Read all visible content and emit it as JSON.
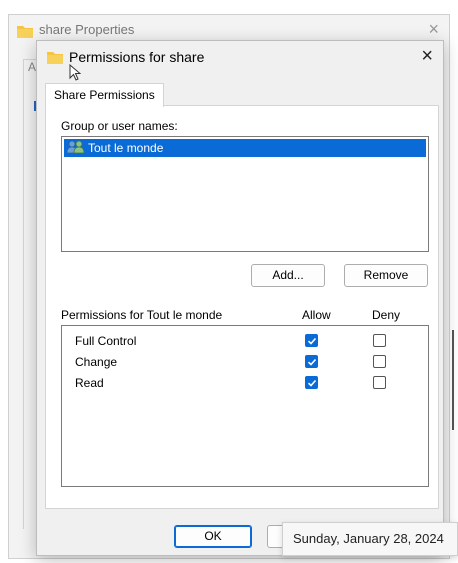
{
  "background_window": {
    "title": "share Properties",
    "tab_letter": "A",
    "close_symbol": "×"
  },
  "dialog": {
    "title": "Permissions for share",
    "close_symbol": "×",
    "tab_label": "Share Permissions",
    "group_label": "Group or user names:",
    "users": [
      {
        "name": "Tout le monde",
        "icon": "users-icon",
        "selected": true
      }
    ],
    "buttons": {
      "add": "Add...",
      "remove": "Remove",
      "ok": "OK"
    },
    "permissions": {
      "header_label": "Permissions for Tout le monde",
      "allow_label": "Allow",
      "deny_label": "Deny",
      "rows": [
        {
          "name": "Full Control",
          "allow": true,
          "deny": false
        },
        {
          "name": "Change",
          "allow": true,
          "deny": false
        },
        {
          "name": "Read",
          "allow": true,
          "deny": false
        }
      ]
    }
  },
  "tooltip": {
    "text": "Sunday, January 28, 2024"
  },
  "colors": {
    "accent": "#0b6bd6",
    "folder": "#f4c542",
    "dialog_bg": "#f0f0f0"
  }
}
